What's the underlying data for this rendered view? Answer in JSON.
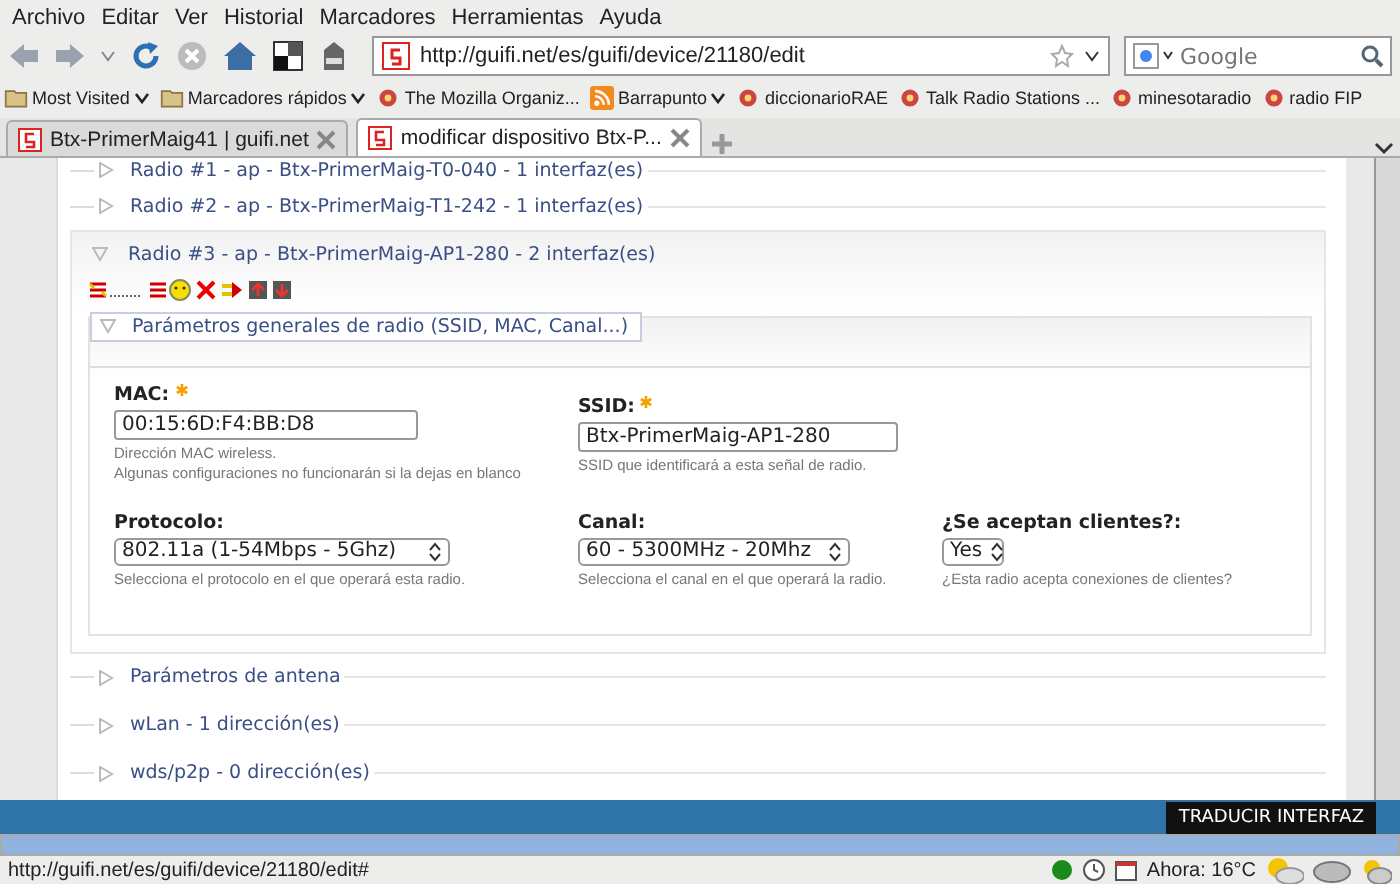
{
  "menu": [
    "Archivo",
    "Editar",
    "Ver",
    "Historial",
    "Marcadores",
    "Herramientas",
    "Ayuda"
  ],
  "toolbar": {
    "url": "http://guifi.net/es/guifi/device/21180/edit",
    "search": {
      "placeholder": "Google"
    }
  },
  "bookmarks": [
    {
      "label": "Most Visited",
      "kind": "folder",
      "dropdown": true
    },
    {
      "label": "Marcadores rápidos",
      "kind": "folder",
      "dropdown": true
    },
    {
      "label": "The Mozilla Organiz...",
      "kind": "site",
      "dropdown": false
    },
    {
      "label": "Barrapunto",
      "kind": "feed",
      "dropdown": true
    },
    {
      "label": "diccionarioRAE",
      "kind": "site",
      "dropdown": false
    },
    {
      "label": "Talk Radio Stations ...",
      "kind": "site",
      "dropdown": false
    },
    {
      "label": "minesotaradio",
      "kind": "site",
      "dropdown": false
    },
    {
      "label": "radio FIP",
      "kind": "site",
      "dropdown": false
    }
  ],
  "tabs": [
    {
      "label": "Btx-PrimerMaig41 | guifi.net",
      "selected": false
    },
    {
      "label": "modificar dispositivo Btx-P...",
      "selected": true
    }
  ],
  "radios": [
    {
      "label": "Radio #1 - ap - Btx-PrimerMaig-T0-040 - 1 interfaz(es)",
      "expanded": false
    },
    {
      "label": "Radio #2 - ap - Btx-PrimerMaig-T1-242 - 1 interfaz(es)",
      "expanded": false
    },
    {
      "label": "Radio #3 - ap - Btx-PrimerMaig-AP1-280 - 2 interfaz(es)",
      "expanded": true,
      "fieldset": {
        "legend": "Parámetros generales de radio (SSID, MAC, Canal...)",
        "expanded": true,
        "rows": [
          [
            {
              "kind": "text",
              "label": "MAC:",
              "required": true,
              "value": "00:15:6D:F4:BB:D8",
              "hints": [
                "Dirección MAC wireless.",
                "Algunas configuraciones no funcionarán si la dejas en blanco"
              ]
            },
            {
              "kind": "text",
              "label": "SSID:",
              "required": true,
              "value": "Btx-PrimerMaig-AP1-280",
              "hints": [
                "SSID que identificará a esta señal de radio."
              ]
            }
          ],
          [
            {
              "kind": "select",
              "label": "Protocolo:",
              "required": false,
              "value": "802.11a (1-54Mbps - 5Ghz)",
              "hints": [
                "Selecciona el protocolo en el que operará esta radio."
              ]
            },
            {
              "kind": "select",
              "label": "Canal:",
              "required": false,
              "value": "60 - 5300MHz - 20Mhz",
              "hints": [
                "Selecciona el canal en el que operará la radio."
              ]
            },
            {
              "kind": "select",
              "label": "¿Se aceptan clientes?:",
              "required": false,
              "value": "Yes",
              "hints": [
                "¿Esta radio acepta conexiones de clientes?"
              ]
            }
          ]
        ]
      },
      "sections": [
        {
          "label": "Parámetros de antena",
          "expanded": false
        },
        {
          "label": "wLan - 1 dirección(es)",
          "expanded": false
        },
        {
          "label": "wds/p2p - 0 dirección(es)",
          "expanded": false
        }
      ]
    }
  ],
  "translate_button": "TRADUCIR INTERFAZ",
  "status_bar": {
    "url": "http://guifi.net/es/guifi/device/21180/edit#",
    "weather": "Ahora: 16°C"
  }
}
